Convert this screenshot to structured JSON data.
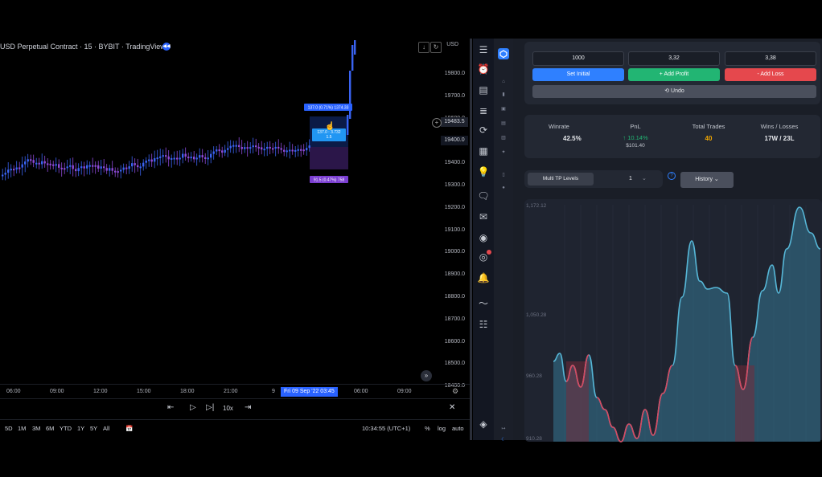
{
  "tv": {
    "title": "USD Perpetual Contract · 15 · BYBIT · TradingView",
    "currency_label": "USD",
    "price_ticks": [
      "19800.0",
      "19700.0",
      "19600.0",
      "19500.0",
      "19400.0",
      "19300.0",
      "19200.0",
      "19100.0",
      "19000.0",
      "18900.0",
      "18800.0",
      "18700.0",
      "18600.0",
      "18500.0",
      "18400.0"
    ],
    "current_price": "19483.5",
    "crosshair_price": "19400.0",
    "time_ticks": [
      "06:00",
      "09:00",
      "12:00",
      "15:00",
      "18:00",
      "21:00",
      "9",
      "06:00",
      "09:00"
    ],
    "time_highlight": "Fri 09 Sep '22   03:45",
    "time_highlight_prefix": "Fri 09",
    "position_labels": {
      "target": "137.0 (0.71%) 1374.33",
      "center": "137.0 : 3.732\n1.5",
      "stop": "91.5 (0.47%) 758"
    },
    "replay": {
      "speed": "10x"
    },
    "ranges": [
      "5D",
      "1M",
      "3M",
      "6M",
      "YTD",
      "1Y",
      "5Y",
      "All"
    ],
    "clock": "10:34:55 (UTC+1)",
    "toggles": [
      "%",
      "log",
      "auto"
    ]
  },
  "calc": {
    "inputs": [
      "1000",
      "3,32",
      "3,38"
    ],
    "buttons": {
      "set_initial": "Set Initial",
      "add_profit": "+ Add Profit",
      "add_loss": "- Add Loss",
      "undo": "⟲ Undo"
    }
  },
  "stats": {
    "winrate_label": "Winrate",
    "winrate_value": "42.5%",
    "pnl_label": "PnL",
    "pnl_value": "↑ 10.14%",
    "pnl_sub": "$101.40",
    "trades_label": "Total Trades",
    "trades_value": "40",
    "wl_label": "Wins / Losses",
    "wl_value": "17W / 23L"
  },
  "controls": {
    "multi_tp": "Multi TP Levels",
    "multi_tp_value": "1",
    "history": "History"
  },
  "equity_chart": {
    "y_labels": [
      "1,172.12",
      "1,050.28",
      "960.28",
      "910.28"
    ]
  },
  "colors": {
    "blue": "#2f80ff",
    "green": "#22b573",
    "red": "#e5484d",
    "cyan": "#56b6d6",
    "loss": "#d9485f"
  }
}
